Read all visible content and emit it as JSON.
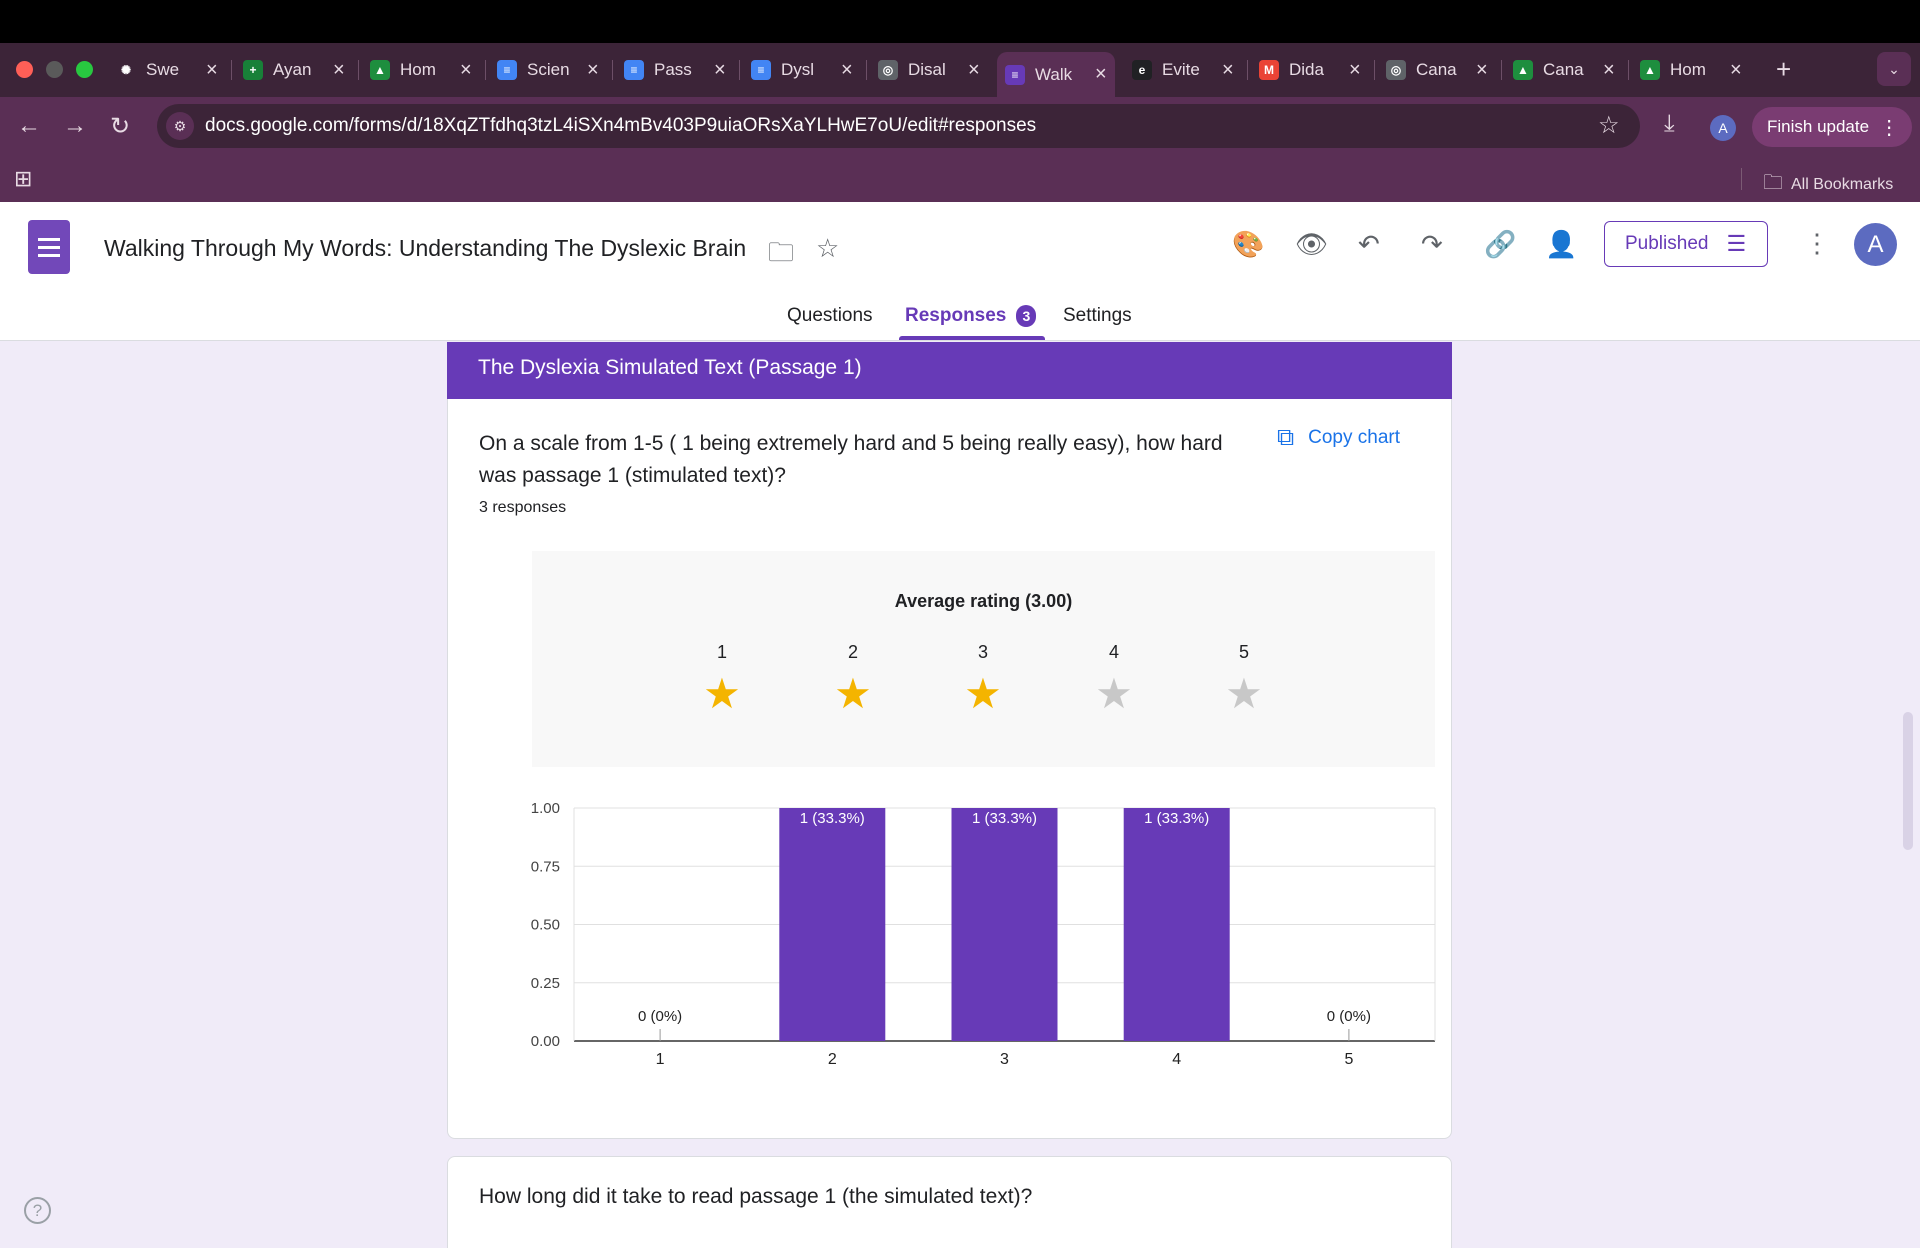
{
  "browser": {
    "tabs": [
      {
        "title": "Swe",
        "color": "#3c2438",
        "glyph": "✺",
        "active": false
      },
      {
        "title": "Ayan",
        "color": "#188038",
        "glyph": "+",
        "active": false
      },
      {
        "title": "Hom",
        "color": "#1e8e3e",
        "glyph": "▲",
        "active": false
      },
      {
        "title": "Scien",
        "color": "#4285f4",
        "glyph": "≡",
        "active": false
      },
      {
        "title": "Pass",
        "color": "#4285f4",
        "glyph": "≡",
        "active": false
      },
      {
        "title": "Dysl",
        "color": "#4285f4",
        "glyph": "≡",
        "active": false
      },
      {
        "title": "Disal",
        "color": "#5f6368",
        "glyph": "◎",
        "active": false
      },
      {
        "title": "Walk",
        "color": "#673ab7",
        "glyph": "≡",
        "active": true
      },
      {
        "title": "Evite",
        "color": "#202124",
        "glyph": "e",
        "active": false
      },
      {
        "title": "Dida",
        "color": "#ea4335",
        "glyph": "M",
        "active": false
      },
      {
        "title": "Cana",
        "color": "#5f6368",
        "glyph": "◎",
        "active": false
      },
      {
        "title": "Cana",
        "color": "#1e8e3e",
        "glyph": "▲",
        "active": false
      },
      {
        "title": "Hom",
        "color": "#1e8e3e",
        "glyph": "▲",
        "active": false
      }
    ],
    "url": "docs.google.com/forms/d/18XqZTfdhq3tzL4iSXn4mBv403P9uiaORsXaYLHwE7oU/edit#responses",
    "finish_update": "Finish update",
    "profile_initial": "A",
    "all_bookmarks": "All Bookmarks"
  },
  "form": {
    "title": "Walking Through My Words: Understanding The Dyslexic Brain",
    "published_label": "Published",
    "avatar_initial": "A",
    "tabs": {
      "questions": "Questions",
      "responses": "Responses",
      "responses_badge": "3",
      "settings": "Settings"
    }
  },
  "section": {
    "title": "The Dyslexia Simulated Text (Passage 1)"
  },
  "question1": {
    "text": "On a scale from 1-5 ( 1 being extremely hard and 5 being really easy), how hard was passage 1 (stimulated text)?",
    "response_count": "3 responses",
    "copy_chart": "Copy chart",
    "average_label": "Average rating (3.00)",
    "rating": 3,
    "rating_max": 5,
    "star_labels": [
      "1",
      "2",
      "3",
      "4",
      "5"
    ]
  },
  "question2": {
    "text": "How long did it take to read passage 1 (the simulated text)?"
  },
  "chart_data": {
    "type": "bar",
    "categories": [
      "1",
      "2",
      "3",
      "4",
      "5"
    ],
    "values": [
      0,
      1,
      1,
      1,
      0
    ],
    "data_labels": [
      "0 (0%)",
      "1 (33.3%)",
      "1 (33.3%)",
      "1 (33.3%)",
      "0 (0%)"
    ],
    "ylim": [
      0,
      1
    ],
    "yticks": [
      "0.00",
      "0.25",
      "0.50",
      "0.75",
      "1.00"
    ],
    "bar_color": "#673ab7",
    "grid": true
  },
  "colors": {
    "accent": "#673ab7",
    "star_filled": "#f4b400",
    "star_empty": "#c8c8c8"
  }
}
